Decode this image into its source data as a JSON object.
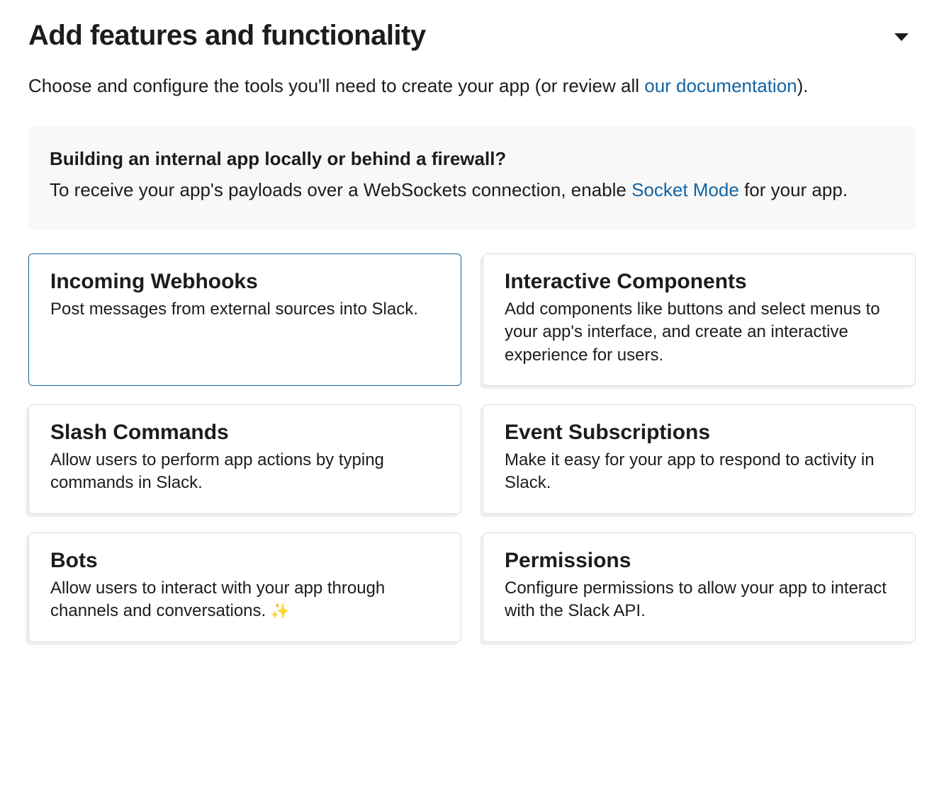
{
  "header": {
    "title": "Add features and functionality"
  },
  "intro": {
    "prefix": "Choose and configure the tools you'll need to create your app (or review all ",
    "link_text": "our documentation",
    "suffix": ")."
  },
  "info_box": {
    "title": "Building an internal app locally or behind a firewall?",
    "text_before_link": "To receive your app's payloads over a WebSockets connection, enable ",
    "link_text": "Socket Mode",
    "text_after_link": " for your app."
  },
  "cards": {
    "incoming_webhooks": {
      "title": "Incoming Webhooks",
      "desc": "Post messages from external sources into Slack."
    },
    "interactive_components": {
      "title": "Interactive Components",
      "desc": "Add components like buttons and select menus to your app's interface, and create an interactive experience for users."
    },
    "slash_commands": {
      "title": "Slash Commands",
      "desc": "Allow users to perform app actions by typing commands in Slack."
    },
    "event_subscriptions": {
      "title": "Event Subscriptions",
      "desc": "Make it easy for your app to respond to activity in Slack."
    },
    "bots": {
      "title": "Bots",
      "desc_before_sparkle": "Allow users to interact with your app through channels and conversations. ",
      "sparkle": "✨"
    },
    "permissions": {
      "title": "Permissions",
      "desc": "Configure permissions to allow your app to interact with the Slack API."
    }
  }
}
